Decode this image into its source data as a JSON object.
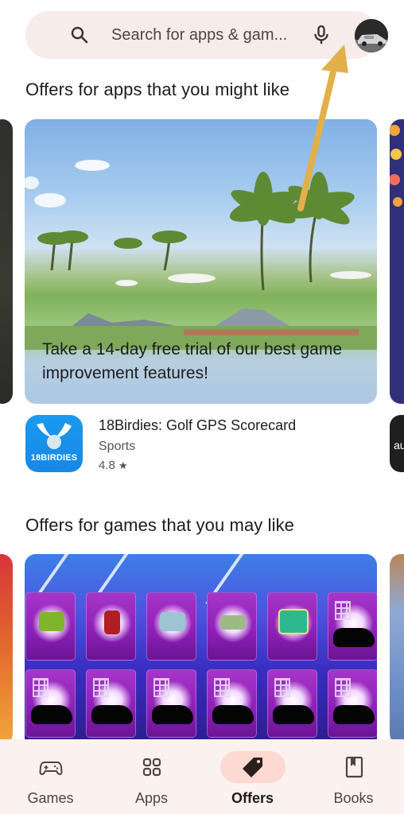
{
  "search": {
    "placeholder": "Search for apps & gam...",
    "icon": "search-icon",
    "voice_icon": "mic-icon",
    "avatar_icon": "account-avatar"
  },
  "sections": [
    {
      "title": "Offers for apps that you might like",
      "featured_offer": {
        "headline": "Take a 14-day free trial of our best game improvement features!"
      },
      "app": {
        "name": "18Birdies: Golf GPS Scorecard",
        "category": "Sports",
        "rating": "4.8",
        "rating_icon": "star-icon",
        "icon_label": "18BIRDIES",
        "icon_color": "#1a8ff0"
      },
      "next_card_peek_text": "au"
    },
    {
      "title": "Offers for games that you may like"
    }
  ],
  "bottom_nav": {
    "items": [
      {
        "label": "Games",
        "icon": "gamepad-icon",
        "active": false
      },
      {
        "label": "Apps",
        "icon": "apps-grid-icon",
        "active": false
      },
      {
        "label": "Offers",
        "icon": "tag-icon",
        "active": true
      },
      {
        "label": "Books",
        "icon": "bookmark-book-icon",
        "active": false
      }
    ]
  },
  "colors": {
    "search_bg": "#f6ecea",
    "nav_bg": "#fbf1ef",
    "active_pill": "#fcd9d1",
    "annotation_arrow": "#e2b04a"
  }
}
